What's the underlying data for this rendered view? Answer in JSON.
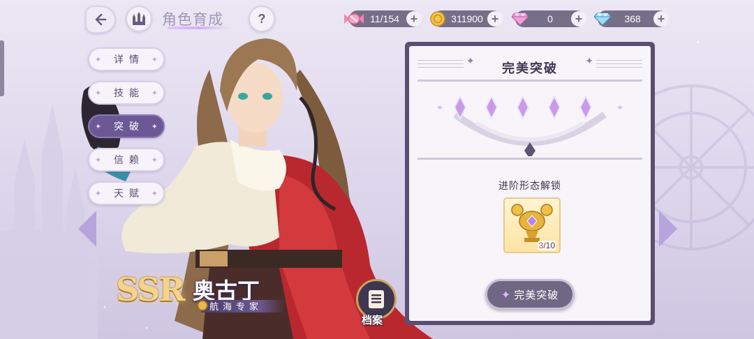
{
  "header": {
    "title": "角色育成",
    "back_icon": "back-arrow-icon",
    "home_icon": "castle-home-icon",
    "help_label": "?"
  },
  "resources": [
    {
      "icon": "candy-icon",
      "value": "11/154",
      "plus": "+"
    },
    {
      "icon": "gold-coin-icon",
      "value": "311900",
      "plus": "+"
    },
    {
      "icon": "pink-diamond-icon",
      "value": "0",
      "plus": "+"
    },
    {
      "icon": "blue-diamond-icon",
      "value": "368",
      "plus": "+"
    }
  ],
  "tabs": [
    {
      "label": "详情",
      "active": false
    },
    {
      "label": "技能",
      "active": false
    },
    {
      "label": "突破",
      "active": true
    },
    {
      "label": "信赖",
      "active": false
    },
    {
      "label": "天赋",
      "active": false
    }
  ],
  "character": {
    "rarity": "SSR",
    "name": "奥古丁",
    "title": "航海专家",
    "archive_label": "档案"
  },
  "panel": {
    "title": "完美突破",
    "stars_filled": 5,
    "stars_total": 5,
    "unlock_label": "进阶形态解锁",
    "item": {
      "icon": "golden-crab-trophy-icon",
      "current": "3",
      "total": "/10"
    },
    "button_label": "完美突破"
  },
  "colors": {
    "accent": "#6b5895",
    "panel_border": "#5a4f72",
    "star": "#c79be8"
  }
}
